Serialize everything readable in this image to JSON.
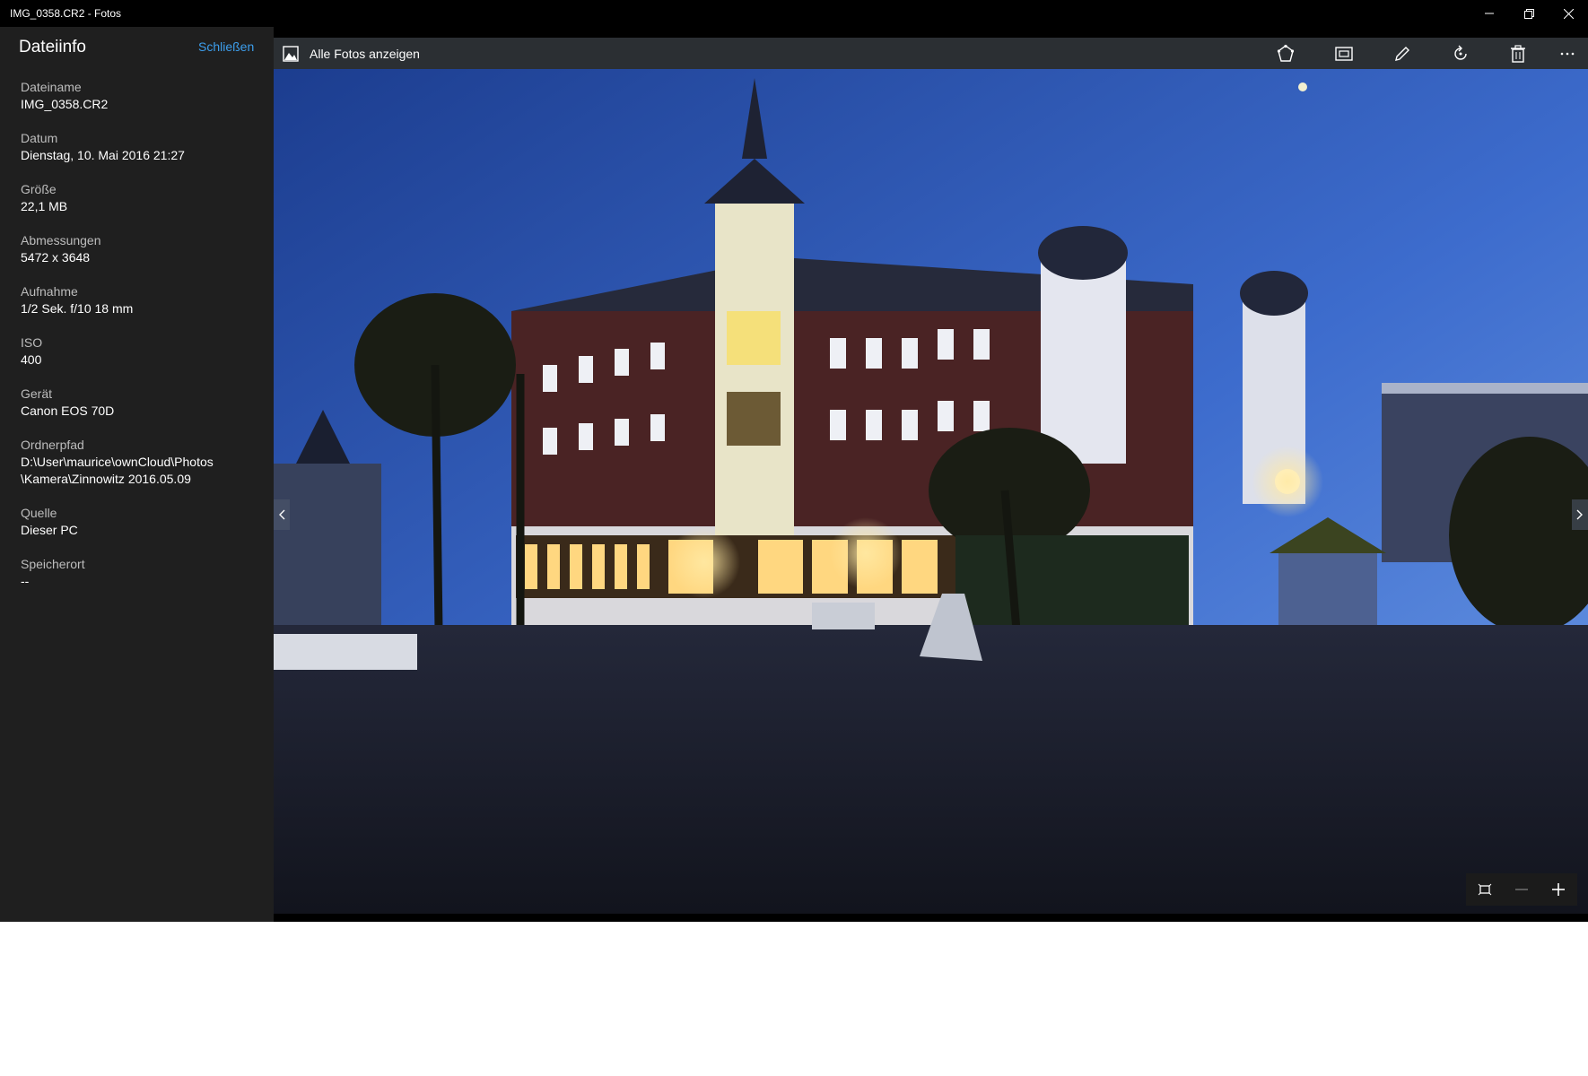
{
  "window": {
    "title": "IMG_0358.CR2 - Fotos",
    "controls": [
      "minimize-icon",
      "restore-icon",
      "close-icon"
    ]
  },
  "panel": {
    "title": "Dateiinfo",
    "close_label": "Schließen",
    "items": [
      {
        "label": "Dateiname",
        "value": "IMG_0358.CR2"
      },
      {
        "label": "Datum",
        "value": "Dienstag, 10. Mai 2016 21:27"
      },
      {
        "label": "Größe",
        "value": "22,1 MB"
      },
      {
        "label": "Abmessungen",
        "value": "5472 x 3648"
      },
      {
        "label": "Aufnahme",
        "value": "1/2 Sek. f/10 18 mm"
      },
      {
        "label": "ISO",
        "value": "400"
      },
      {
        "label": "Gerät",
        "value": "Canon EOS 70D"
      },
      {
        "label": "Ordnerpfad",
        "value": "D:\\User\\maurice\\ownCloud\\Photos",
        "value2": "\\Kamera\\Zinnowitz 2016.05.09"
      },
      {
        "label": "Quelle",
        "value": "Dieser PC"
      },
      {
        "label": "Speicherort",
        "value": "--"
      }
    ]
  },
  "toolbar": {
    "all_photos_label": "Alle Fotos anzeigen",
    "buttons": [
      "share-icon",
      "slideshow-icon",
      "edit-icon",
      "rotate-icon",
      "delete-icon",
      "more-icon"
    ]
  },
  "zoom_controls": [
    "fit-screen-icon",
    "zoom-out-icon",
    "zoom-in-icon"
  ],
  "colors": {
    "accent": "#3d9eec",
    "panel_bg": "#1f1f1f",
    "command_bar": "#2b2f33"
  }
}
